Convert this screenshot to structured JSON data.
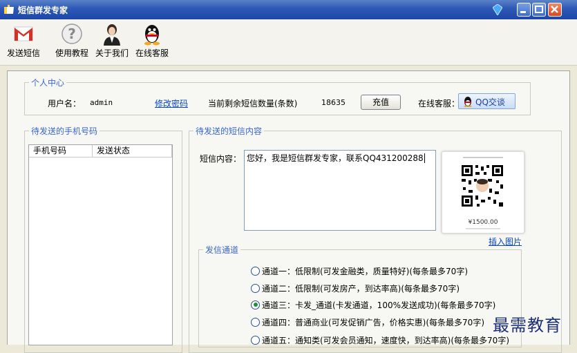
{
  "window": {
    "title": "短信群发专家"
  },
  "toolbar": {
    "items": [
      {
        "label": "发送短信",
        "icon": "gmail-m-icon"
      },
      {
        "label": "使用教程",
        "icon": "help-question-icon"
      },
      {
        "label": "关于我们",
        "icon": "person-avatar-icon"
      },
      {
        "label": "在线客服",
        "icon": "qq-penguin-icon"
      }
    ]
  },
  "personal_center": {
    "legend": "个人中心",
    "username_label": "用户名：",
    "username_value": "admin",
    "change_password_link": "修改密码",
    "remaining_label": "当前剩余短信数量(条数)",
    "remaining_value": "18635",
    "recharge_button": "充值",
    "online_service_label": "在线客服：",
    "qq_chat_button": "QQ交谈"
  },
  "phone_list": {
    "legend": "待发送的手机号码",
    "columns": [
      "手机号码",
      "发送状态"
    ]
  },
  "sms_content": {
    "legend": "待发送的短信内容",
    "content_label": "短信内容：",
    "content_value": "您好，我是短信群发专家，联系QQ431200288",
    "qr_caption": "¥1500.00",
    "insert_image_link": "插入图片"
  },
  "channels": {
    "legend": "发信通道",
    "selected_index": 2,
    "options": [
      "通道一：低限制(可发金融类，质量特好)(每条最多70字)",
      "通道二：低限制(可发房产，到达率高)(每条最多70字)",
      "通道三：卡发_通道(卡发通道，100%发送成功)(每条最多70字)",
      "通道四：普通商业(可发促销广告，价格实惠)(每条最多70字)",
      "通道五：通知类(可发会员通知，速度快，到达率高)(每条最多70字)"
    ]
  },
  "watermark": "最需教育",
  "colors": {
    "title_bar": "#2d58b5",
    "legend_text": "#3a67c8",
    "link": "#0645c8",
    "close_button": "#d34a24"
  }
}
